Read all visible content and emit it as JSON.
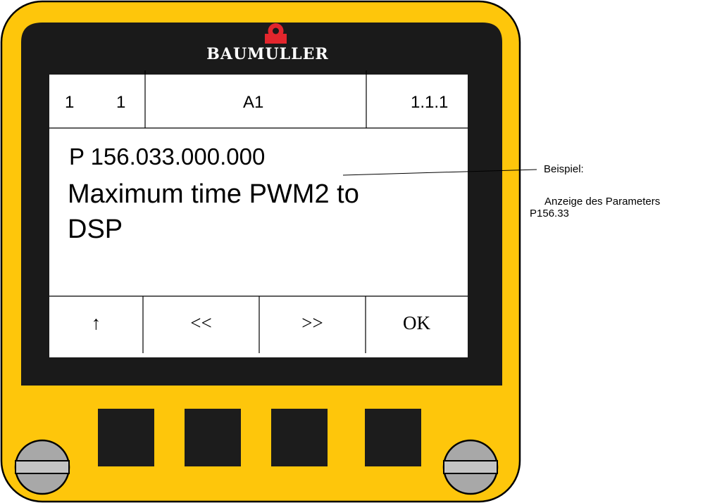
{
  "brand": {
    "name": "BAUMULLER"
  },
  "display": {
    "status": {
      "left_a": "1",
      "left_b": "1",
      "center": "A1",
      "right": "1.1.1"
    },
    "parameter_id": "P 156.033.000.000",
    "parameter_description_line1": "Maximum time PWM2 to",
    "parameter_description_line2": "DSP",
    "softkeys": [
      {
        "label": "↑"
      },
      {
        "label": "<<"
      },
      {
        "label": ">>"
      },
      {
        "label": "OK"
      }
    ]
  },
  "annotation": {
    "title": "Beispiel:",
    "line1": "Anzeige des Parameters",
    "line2": "P156.33"
  },
  "colors": {
    "housing_yellow": "#fec60b",
    "bezel_black": "#1a1a1a",
    "lcd_white": "#ffffff",
    "logo_red": "#e3262d",
    "button_dark": "#1c1c1c",
    "screw_gray": "#a8a8a8"
  }
}
